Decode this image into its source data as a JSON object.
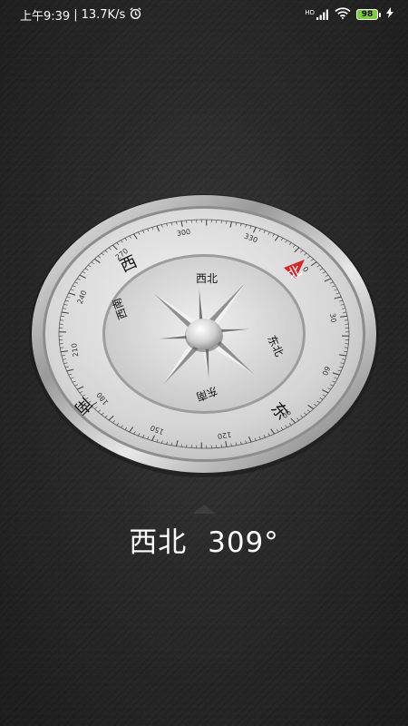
{
  "status_bar": {
    "time": "上午9:39",
    "separator": "|",
    "network_speed": "13.7K/s",
    "signal_label": "HD",
    "battery": "98"
  },
  "compass": {
    "outer_cardinals": {
      "north": "北",
      "east": "东",
      "south": "南",
      "west": "西"
    },
    "inner_directions": {
      "northwest": "西北",
      "northeast": "东北",
      "southeast": "东南",
      "southwest": "西南"
    },
    "degree_labels": [
      "0",
      "30",
      "60",
      "90",
      "120",
      "150",
      "180",
      "210",
      "240",
      "270",
      "300",
      "330"
    ],
    "heading_degrees": 309,
    "colors": {
      "north_marker": "#d6262a",
      "bezel": "#d9d9d9",
      "face": "#e2e2e2"
    }
  },
  "reading": {
    "direction": "西北",
    "degrees": "309°"
  }
}
